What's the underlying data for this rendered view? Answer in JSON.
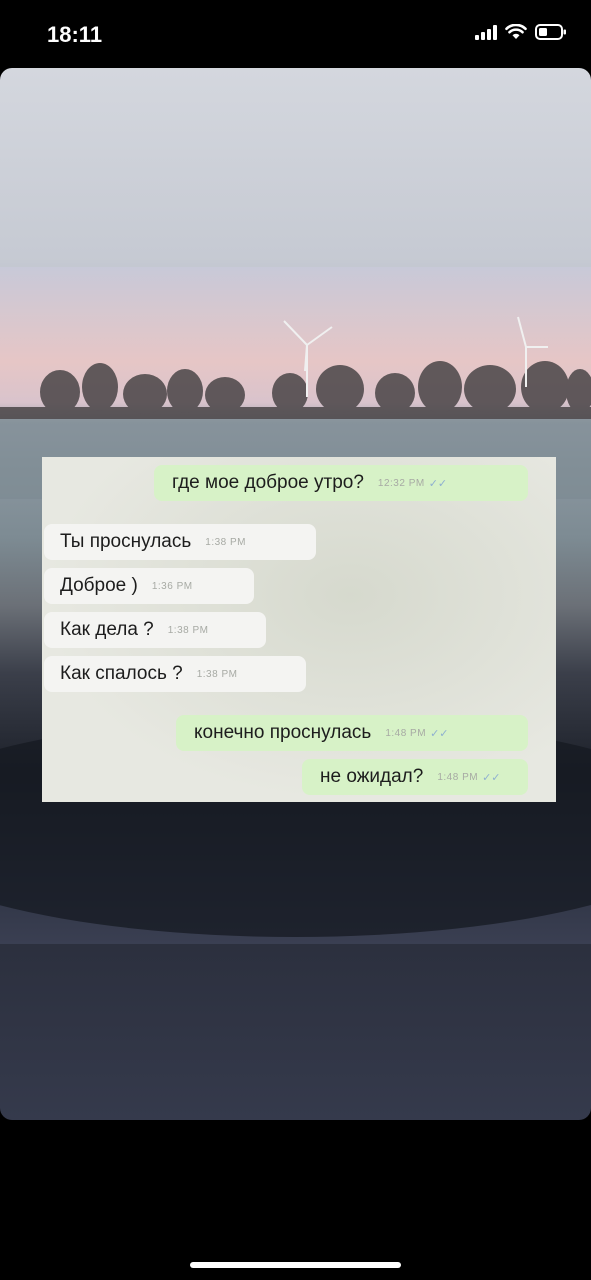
{
  "status_bar": {
    "time": "18:11",
    "icons": [
      "signal-icon",
      "wifi-icon",
      "battery-icon"
    ]
  },
  "chat": {
    "messages": [
      {
        "direction": "outgoing",
        "text": "где мое доброе утро?",
        "time": "12:32 PM",
        "read_receipt": "double-tick-icon"
      },
      {
        "direction": "incoming",
        "text": "Ты проснулась",
        "time": "1:38 PM"
      },
      {
        "direction": "incoming",
        "text": "Доброе )",
        "time": "1:36 PM"
      },
      {
        "direction": "incoming",
        "text": "Как дела ?",
        "time": "1:38 PM"
      },
      {
        "direction": "incoming",
        "text": "Как спалось ?",
        "time": "1:38 PM"
      },
      {
        "direction": "outgoing",
        "text": "конечно проснулась",
        "time": "1:48 PM",
        "read_receipt": "double-tick-icon"
      },
      {
        "direction": "outgoing",
        "text": "не ожидал?",
        "time": "1:48 PM",
        "read_receipt": "double-tick-icon"
      }
    ]
  },
  "colors": {
    "incoming_bubble": "#f4f4f2",
    "outgoing_bubble": "#d7f2c7",
    "read_ticks": "#8fb0d0"
  }
}
